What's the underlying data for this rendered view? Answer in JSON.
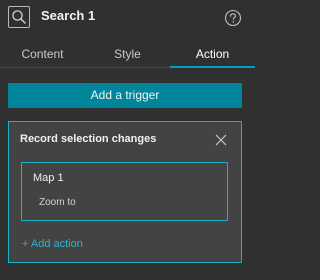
{
  "header": {
    "title": "Search 1",
    "icon": "search-icon",
    "help_icon": "help-icon"
  },
  "tabs": [
    {
      "label": "Content",
      "active": false
    },
    {
      "label": "Style",
      "active": false
    },
    {
      "label": "Action",
      "active": true
    }
  ],
  "main": {
    "add_trigger_label": "Add a trigger",
    "trigger": {
      "title": "Record selection changes",
      "target": "Map 1",
      "action": "Zoom to",
      "add_action_label": "+ Add action"
    }
  },
  "colors": {
    "background": "#303030",
    "accent": "#14b3c9",
    "button": "#00859b"
  }
}
